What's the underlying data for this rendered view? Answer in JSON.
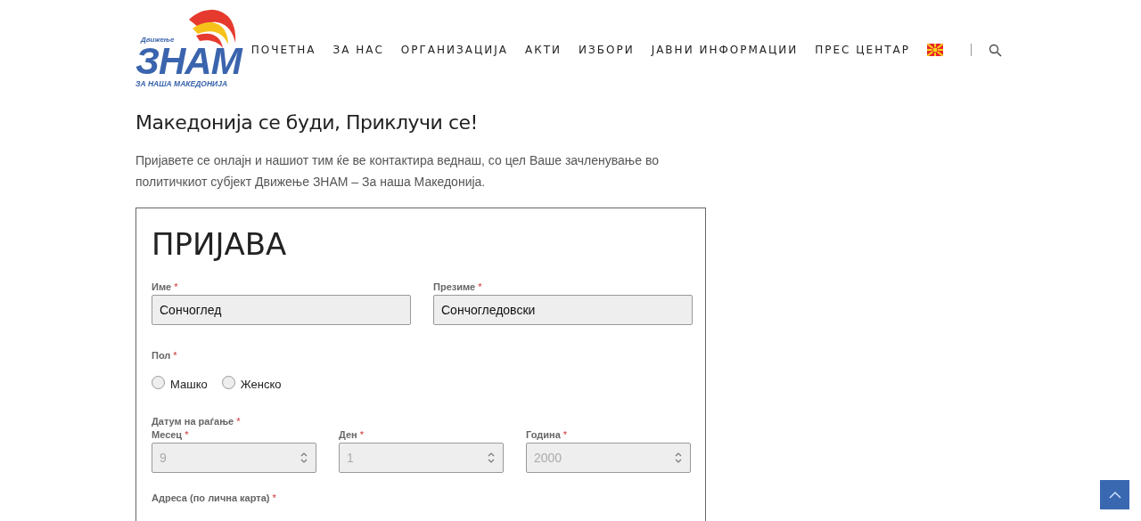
{
  "logo": {
    "top_text": "Движење",
    "main_text": "ЗНАМ",
    "bottom_text": "ЗА НАША МАКЕДОНИЈА"
  },
  "nav": {
    "items": [
      "ПОЧЕТНА",
      "ЗА НАС",
      "ОРГАНИЗАЦИЈА",
      "АКТИ",
      "ИЗБОРИ",
      "ЈАВНИ ИНФОРМАЦИИ",
      "ПРЕС ЦЕНТАР"
    ]
  },
  "heading": "Македонија се буди, Приклучи се!",
  "intro": "Пријавете се онлајн и нашиот тим ќе ве контактира веднаш, со цел Ваше зачленување во политичкиот субјект Движење ЗНАМ – За наша Македонија.",
  "form": {
    "title": "ПРИЈАВА",
    "name_fields": [
      {
        "label": "Име",
        "mark": "*",
        "value": "Сончоглед"
      },
      {
        "label": "Презиме",
        "mark": "*",
        "value": "Сончогледовски"
      }
    ],
    "gender": {
      "label": "Пол",
      "mark": "*",
      "options": [
        {
          "label": "Машко",
          "selected": false
        },
        {
          "label": "Женско",
          "selected": false
        }
      ]
    },
    "birth_date": {
      "label": "Датум на раѓање",
      "mark": "*",
      "fields": [
        {
          "label": "Месец",
          "mark": "*",
          "placeholder": "9"
        },
        {
          "label": "Ден",
          "mark": "*",
          "placeholder": "1"
        },
        {
          "label": "Година",
          "mark": "*",
          "placeholder": "2000"
        }
      ]
    },
    "address": {
      "label": "Адреса (по лична карта)",
      "mark": "*"
    }
  }
}
